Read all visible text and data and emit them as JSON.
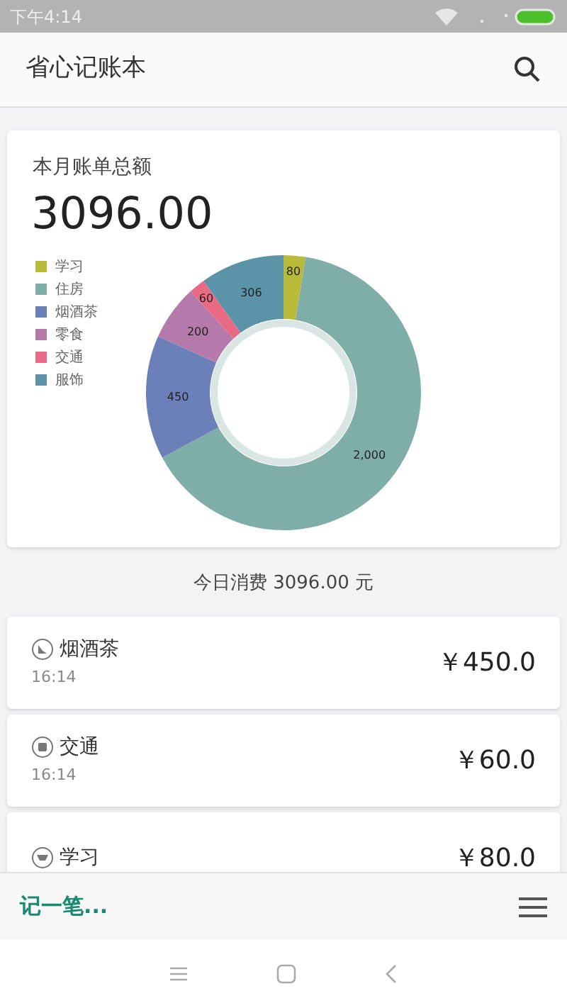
{
  "status_bar": {
    "time": "下午4:14"
  },
  "app_bar": {
    "title": "省心记账本"
  },
  "summary": {
    "label": "本月账单总额",
    "total": "3096.00",
    "chart_data": {
      "type": "donut",
      "categories": [
        "学习",
        "住房",
        "烟酒茶",
        "零食",
        "交通",
        "服饰"
      ],
      "values": [
        80,
        2000,
        450,
        200,
        60,
        306
      ],
      "colors": [
        "#b9b93a",
        "#7fada8",
        "#6b7fb8",
        "#b57aab",
        "#ea6a86",
        "#5b93a8"
      ],
      "value_labels": [
        "80",
        "2,000",
        "450",
        "200",
        "60",
        "306"
      ],
      "legend": "left"
    }
  },
  "today": "今日消费 3096.00 元",
  "records": [
    {
      "category": "烟酒茶",
      "time": "16:14",
      "amount": "￥450.0"
    },
    {
      "category": "交通",
      "time": "16:14",
      "amount": "￥60.0"
    },
    {
      "category": "学习",
      "amount": "￥80.0"
    }
  ],
  "bottom_bar": {
    "add_label": "记一笔..."
  }
}
